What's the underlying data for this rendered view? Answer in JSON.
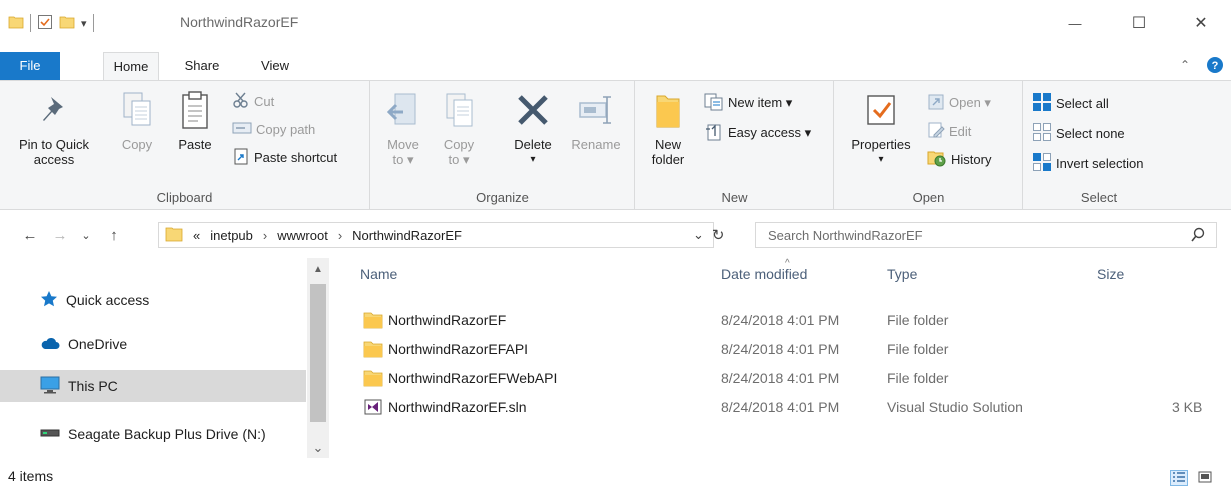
{
  "window": {
    "title": "NorthwindRazorEF",
    "minimize_glyph": "—",
    "maximize_glyph": "☐",
    "close_glyph": "✕",
    "qat_customize_glyph": "▾"
  },
  "tabs": [
    {
      "label": "File"
    },
    {
      "label": "Home"
    },
    {
      "label": "Share"
    },
    {
      "label": "View"
    }
  ],
  "ribbon": {
    "clipboard": {
      "label": "Clipboard",
      "pin_label_1": "Pin to Quick",
      "pin_label_2": "access",
      "copy_label": "Copy",
      "paste_label": "Paste",
      "cut_label": "Cut",
      "copy_path_label": "Copy path",
      "paste_shortcut_label": "Paste shortcut"
    },
    "organize": {
      "label": "Organize",
      "move_label_1": "Move",
      "move_label_2": "to ▾",
      "copyto_label_1": "Copy",
      "copyto_label_2": "to ▾",
      "delete_label": "Delete",
      "delete_arrow": "▾",
      "rename_label": "Rename"
    },
    "new": {
      "label": "New",
      "new_folder_1": "New",
      "new_folder_2": "folder",
      "new_item_label": "New item ▾",
      "easy_access_label": "Easy access ▾"
    },
    "open": {
      "label": "Open",
      "properties_label": "Properties",
      "properties_arrow": "▾",
      "open_label": "Open ▾",
      "edit_label": "Edit",
      "history_label": "History"
    },
    "select": {
      "label": "Select",
      "select_all_label": "Select all",
      "select_none_label": "Select none",
      "invert_label": "Invert selection"
    }
  },
  "address": {
    "overflow": "«",
    "crumbs": [
      "inetpub",
      "wwwroot",
      "NorthwindRazorEF"
    ],
    "separator": "›",
    "dropdown_glyph": "⌄",
    "refresh_glyph": "↻",
    "back_glyph": "←",
    "forward_glyph": "→",
    "recent_glyph": "⌄",
    "up_glyph": "↑"
  },
  "search": {
    "placeholder": "Search NorthwindRazorEF"
  },
  "sidebar": {
    "items": [
      {
        "label": "Quick access",
        "icon": "star-icon"
      },
      {
        "label": "OneDrive",
        "icon": "cloud-icon"
      },
      {
        "label": "This PC",
        "icon": "monitor-icon",
        "selected": true
      },
      {
        "label": "Seagate Backup Plus Drive (N:)",
        "icon": "drive-icon"
      }
    ],
    "scroll_up_glyph": "▲",
    "scroll_down_glyph": "⌄"
  },
  "columns": {
    "name": "Name",
    "date": "Date modified",
    "type": "Type",
    "size": "Size",
    "sort_glyph": "^"
  },
  "files": [
    {
      "name": "NorthwindRazorEF",
      "date": "8/24/2018 4:01 PM",
      "type": "File folder",
      "size": "",
      "icon": "folder-icon"
    },
    {
      "name": "NorthwindRazorEFAPI",
      "date": "8/24/2018 4:01 PM",
      "type": "File folder",
      "size": "",
      "icon": "folder-icon"
    },
    {
      "name": "NorthwindRazorEFWebAPI",
      "date": "8/24/2018 4:01 PM",
      "type": "File folder",
      "size": "",
      "icon": "folder-icon"
    },
    {
      "name": "NorthwindRazorEF.sln",
      "date": "8/24/2018 4:01 PM",
      "type": "Visual Studio Solution",
      "size": "3 KB",
      "icon": "visual-studio-solution-icon"
    }
  ],
  "status": {
    "items_count": "4 items"
  },
  "colors": {
    "file_tab": "#1979ca",
    "folder": "#f8d775",
    "selected": "#d9d9d9",
    "accent": "#0063b1"
  }
}
